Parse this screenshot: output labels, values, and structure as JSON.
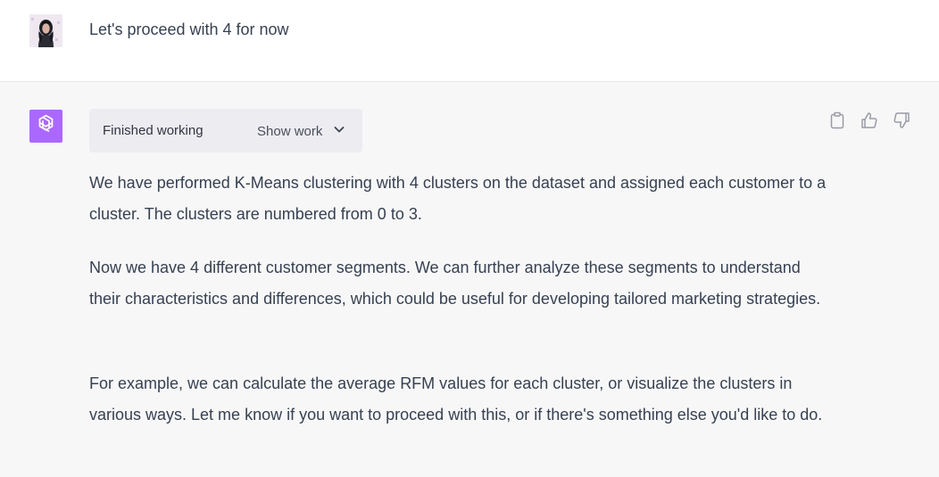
{
  "user": {
    "message": "Let's proceed with 4 for now"
  },
  "assistant": {
    "work_status": "Finished working",
    "show_work_label": "Show work",
    "paragraphs": [
      "We have performed K-Means clustering with 4 clusters on the dataset and assigned each customer to a cluster. The clusters are numbered from 0 to 3.",
      "Now we have 4 different customer segments. We can further analyze these segments to understand their characteristics and differences, which could be useful for developing tailored marketing strategies.",
      "For example, we can calculate the average RFM values for each cluster, or visualize the clusters in various ways. Let me know if you want to proceed with this, or if there's something else you'd like to do."
    ]
  },
  "icons": {
    "assistant_logo": "openai-logo-icon",
    "copy": "clipboard-icon",
    "like": "thumbs-up-icon",
    "dislike": "thumbs-down-icon",
    "expand": "chevron-down-icon"
  },
  "colors": {
    "assistant_avatar_bg": "#ab68ff",
    "assistant_bg": "#f7f7f8",
    "work_panel_bg": "#ececf1",
    "text": "#374151"
  }
}
